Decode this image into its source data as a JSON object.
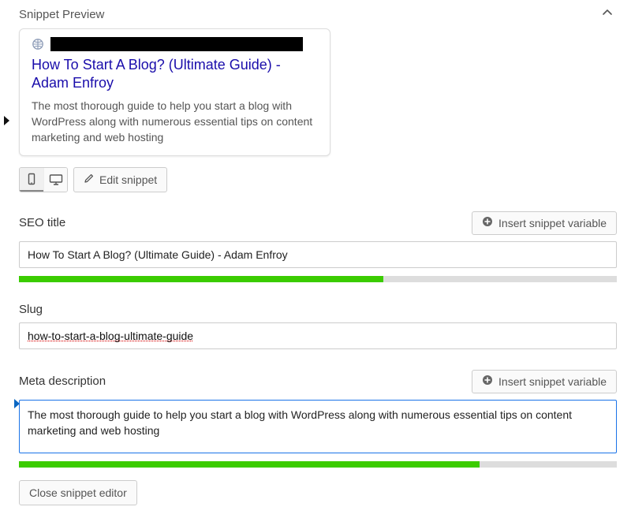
{
  "header": {
    "title": "Snippet Preview"
  },
  "preview": {
    "title": "How To Start A Blog? (Ultimate Guide) - Adam Enfroy",
    "description": "The most thorough guide to help you start a blog with WordPress along with numerous essential tips on content marketing and web hosting"
  },
  "toolbar": {
    "edit_label": "Edit snippet"
  },
  "fields": {
    "seo_title_label": "SEO title",
    "seo_title_value": "How To Start A Blog? (Ultimate Guide)  - Adam Enfroy",
    "seo_insert_label": "Insert snippet variable",
    "seo_progress_pct": 61,
    "slug_label": "Slug",
    "slug_value": "how-to-start-a-blog-ultimate-guide",
    "meta_label": "Meta description",
    "meta_value": "The most thorough guide to help you start a blog with WordPress along with numerous essential tips on content marketing and web hosting",
    "meta_insert_label": "Insert snippet variable",
    "meta_progress_pct": 77
  },
  "footer": {
    "close_label": "Close snippet editor"
  }
}
